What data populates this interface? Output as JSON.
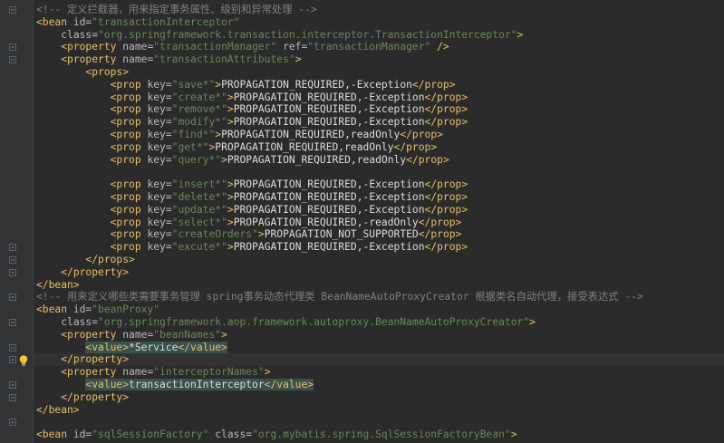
{
  "editor": {
    "lines": [
      {
        "indent": "",
        "segs": [
          [
            "c",
            "<!-- 定义拦截器，用来指定事务属性、级别和异常处理 -->"
          ]
        ]
      },
      {
        "indent": "",
        "segs": [
          [
            "t",
            "<bean "
          ],
          [
            "a",
            "id="
          ],
          [
            "v",
            "\"transactionInterceptor\""
          ]
        ]
      },
      {
        "indent": "    ",
        "segs": [
          [
            "a",
            "class="
          ],
          [
            "v",
            "\"org.springframework.transaction.interceptor.TransactionInterceptor\""
          ],
          [
            "t",
            ">"
          ]
        ]
      },
      {
        "indent": "    ",
        "segs": [
          [
            "t",
            "<property "
          ],
          [
            "a",
            "name="
          ],
          [
            "v",
            "\"transactionManager\" "
          ],
          [
            "a",
            "ref="
          ],
          [
            "v",
            "\"transactionManager\""
          ],
          [
            "t",
            " />"
          ]
        ]
      },
      {
        "indent": "    ",
        "segs": [
          [
            "t",
            "<property "
          ],
          [
            "a",
            "name="
          ],
          [
            "v",
            "\"transactionAttributes\""
          ],
          [
            "t",
            ">"
          ]
        ]
      },
      {
        "indent": "        ",
        "segs": [
          [
            "t",
            "<props>"
          ]
        ]
      },
      {
        "indent": "            ",
        "segs": [
          [
            "t",
            "<prop "
          ],
          [
            "a",
            "key="
          ],
          [
            "v",
            "\"save*\""
          ],
          [
            "t",
            ">"
          ],
          [
            "tx",
            "PROPAGATION_REQUIRED,-Exception"
          ],
          [
            "t",
            "</prop>"
          ]
        ]
      },
      {
        "indent": "            ",
        "segs": [
          [
            "t",
            "<prop "
          ],
          [
            "a",
            "key="
          ],
          [
            "v",
            "\"create*\""
          ],
          [
            "t",
            ">"
          ],
          [
            "tx",
            "PROPAGATION_REQUIRED,-Exception"
          ],
          [
            "t",
            "</prop>"
          ]
        ]
      },
      {
        "indent": "            ",
        "segs": [
          [
            "t",
            "<prop "
          ],
          [
            "a",
            "key="
          ],
          [
            "v",
            "\"remove*\""
          ],
          [
            "t",
            ">"
          ],
          [
            "tx",
            "PROPAGATION_REQUIRED,-Exception"
          ],
          [
            "t",
            "</prop>"
          ]
        ]
      },
      {
        "indent": "            ",
        "segs": [
          [
            "t",
            "<prop "
          ],
          [
            "a",
            "key="
          ],
          [
            "v",
            "\"modify*\""
          ],
          [
            "t",
            ">"
          ],
          [
            "tx",
            "PROPAGATION_REQUIRED,-Exception"
          ],
          [
            "t",
            "</prop>"
          ]
        ]
      },
      {
        "indent": "            ",
        "segs": [
          [
            "t",
            "<prop "
          ],
          [
            "a",
            "key="
          ],
          [
            "v",
            "\"find*\""
          ],
          [
            "t",
            ">"
          ],
          [
            "tx",
            "PROPAGATION_REQUIRED,readOnly"
          ],
          [
            "t",
            "</prop>"
          ]
        ]
      },
      {
        "indent": "            ",
        "segs": [
          [
            "t",
            "<prop "
          ],
          [
            "a",
            "key="
          ],
          [
            "v",
            "\"get*\""
          ],
          [
            "t",
            ">"
          ],
          [
            "tx",
            "PROPAGATION_REQUIRED,readOnly"
          ],
          [
            "t",
            "</prop>"
          ]
        ]
      },
      {
        "indent": "            ",
        "segs": [
          [
            "t",
            "<prop "
          ],
          [
            "a",
            "key="
          ],
          [
            "v",
            "\"query*\""
          ],
          [
            "t",
            ">"
          ],
          [
            "tx",
            "PROPAGATION_REQUIRED,readOnly"
          ],
          [
            "t",
            "</prop>"
          ]
        ]
      },
      {
        "indent": "",
        "segs": []
      },
      {
        "indent": "            ",
        "segs": [
          [
            "t",
            "<prop "
          ],
          [
            "a",
            "key="
          ],
          [
            "v",
            "\"insert*\""
          ],
          [
            "t",
            ">"
          ],
          [
            "tx",
            "PROPAGATION_REQUIRED,-Exception"
          ],
          [
            "t",
            "</prop>"
          ]
        ]
      },
      {
        "indent": "            ",
        "segs": [
          [
            "t",
            "<prop "
          ],
          [
            "a",
            "key="
          ],
          [
            "v",
            "\"delete*\""
          ],
          [
            "t",
            ">"
          ],
          [
            "tx",
            "PROPAGATION_REQUIRED,-Exception"
          ],
          [
            "t",
            "</prop>"
          ]
        ]
      },
      {
        "indent": "            ",
        "segs": [
          [
            "t",
            "<prop "
          ],
          [
            "a",
            "key="
          ],
          [
            "v",
            "\"update*\""
          ],
          [
            "t",
            ">"
          ],
          [
            "tx",
            "PROPAGATION_REQUIRED,-Exception"
          ],
          [
            "t",
            "</prop>"
          ]
        ]
      },
      {
        "indent": "            ",
        "segs": [
          [
            "t",
            "<prop "
          ],
          [
            "a",
            "key="
          ],
          [
            "v",
            "\"select*\""
          ],
          [
            "t",
            ">"
          ],
          [
            "tx",
            "PROPAGATION_REQUIRED,-readOnly"
          ],
          [
            "t",
            "</prop>"
          ]
        ]
      },
      {
        "indent": "            ",
        "segs": [
          [
            "t",
            "<prop "
          ],
          [
            "a",
            "key="
          ],
          [
            "v",
            "\"createOrders\""
          ],
          [
            "t",
            ">"
          ],
          [
            "tx",
            "PROPAGATION_NOT_SUPPORTED"
          ],
          [
            "t",
            "</prop>"
          ]
        ]
      },
      {
        "indent": "            ",
        "segs": [
          [
            "t",
            "<prop "
          ],
          [
            "a",
            "key="
          ],
          [
            "v",
            "\"excute*\""
          ],
          [
            "t",
            ">"
          ],
          [
            "tx",
            "PROPAGATION_REQUIRED,-Exception"
          ],
          [
            "t",
            "</prop>"
          ]
        ]
      },
      {
        "indent": "        ",
        "segs": [
          [
            "t",
            "</props>"
          ]
        ]
      },
      {
        "indent": "    ",
        "segs": [
          [
            "t",
            "</property>"
          ]
        ]
      },
      {
        "indent": "",
        "segs": [
          [
            "t",
            "</bean>"
          ]
        ]
      },
      {
        "indent": "",
        "segs": [
          [
            "c",
            "<!-- 用来定义哪些类需要事务管理 spring事务动态代理类 BeanNameAutoProxyCreator 根据类名自动代理，接受表达式 -->"
          ]
        ]
      },
      {
        "indent": "",
        "segs": [
          [
            "t",
            "<bean "
          ],
          [
            "a",
            "id="
          ],
          [
            "v",
            "\"beanProxy\""
          ]
        ]
      },
      {
        "indent": "    ",
        "segs": [
          [
            "a",
            "class="
          ],
          [
            "v",
            "\"org.springframework.aop.framework.autoproxy.BeanNameAutoProxyCreator\""
          ],
          [
            "t",
            ">"
          ]
        ]
      },
      {
        "indent": "    ",
        "segs": [
          [
            "t",
            "<property "
          ],
          [
            "a",
            "name="
          ],
          [
            "v",
            "\"beanNames\""
          ],
          [
            "t",
            ">"
          ]
        ]
      },
      {
        "indent": "        ",
        "segs": [
          [
            "t",
            "<value>",
            "hl"
          ],
          [
            "tx",
            "*Service",
            "hl"
          ],
          [
            "t",
            "</value>",
            "hl"
          ]
        ]
      },
      {
        "indent": "    ",
        "segs": [
          [
            "t",
            "</property>"
          ]
        ]
      },
      {
        "indent": "    ",
        "segs": [
          [
            "t",
            "<property "
          ],
          [
            "a",
            "name="
          ],
          [
            "v",
            "\"interceptorNames\""
          ],
          [
            "t",
            ">"
          ]
        ]
      },
      {
        "indent": "        ",
        "segs": [
          [
            "t",
            "<value>",
            "hl"
          ],
          [
            "tx",
            "transactionInterceptor",
            "hl"
          ],
          [
            "t",
            "</value>",
            "hl"
          ]
        ]
      },
      {
        "indent": "    ",
        "segs": [
          [
            "t",
            "</property>"
          ]
        ]
      },
      {
        "indent": "",
        "segs": [
          [
            "t",
            "</bean>"
          ]
        ]
      },
      {
        "indent": "",
        "segs": []
      },
      {
        "indent": "",
        "segs": [
          [
            "t",
            "<bean "
          ],
          [
            "a",
            "id="
          ],
          [
            "v",
            "\"sqlSessionFactory\" "
          ],
          [
            "a",
            "class="
          ],
          [
            "v",
            "\"org.mybatis.spring.SqlSessionFactoryBean\""
          ],
          [
            "t",
            ">"
          ]
        ]
      }
    ],
    "current_line_index": 28,
    "fold_lines": [
      1,
      4,
      5,
      20,
      21,
      22,
      24,
      26,
      28,
      29,
      31,
      32,
      34
    ],
    "colors": {
      "background": "#2b2b2b",
      "gutter": "#313335",
      "tag": "#e8bf6a",
      "attribute": "#bababa",
      "string": "#6a8759",
      "comment": "#808080",
      "text": "#dcdcdc"
    },
    "icons": {
      "intention": "lightbulb-icon",
      "fold": "fold-marker-icon"
    }
  }
}
